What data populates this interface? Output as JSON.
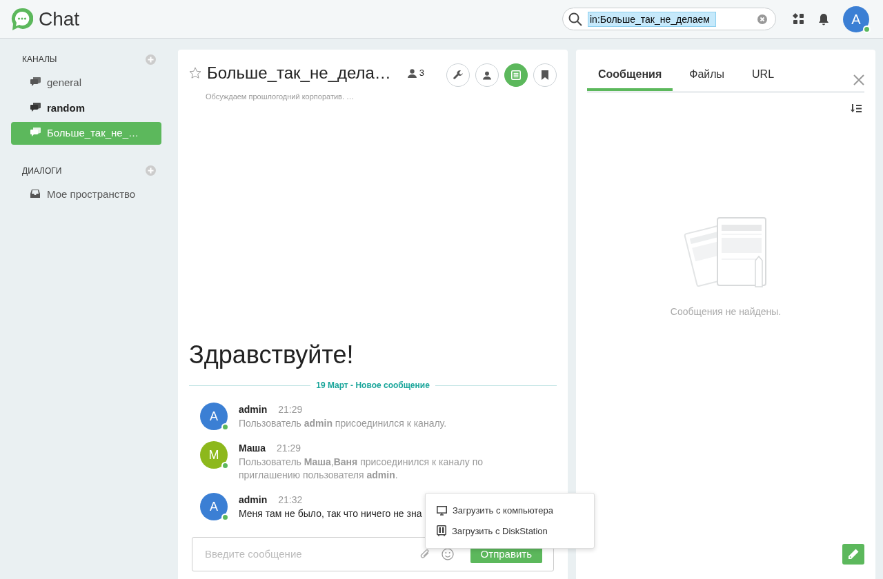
{
  "app": {
    "title": "Chat"
  },
  "search": {
    "value": "in:Больше_так_не_делаем"
  },
  "user": {
    "initial": "A",
    "online": true
  },
  "sidebar": {
    "sections": [
      {
        "title": "КАНАЛЫ",
        "items": [
          {
            "label": "general",
            "kind": "channel",
            "unread": false,
            "selected": false
          },
          {
            "label": "random",
            "kind": "channel",
            "unread": true,
            "selected": false
          },
          {
            "label": "Больше_так_не_…",
            "kind": "channel",
            "unread": false,
            "selected": true
          }
        ]
      },
      {
        "title": "ДИАЛОГИ",
        "items": [
          {
            "label": "Мое пространство",
            "kind": "inbox",
            "unread": false,
            "selected": false
          }
        ]
      }
    ]
  },
  "channel": {
    "title": "Больше_так_не_дела…",
    "starred": false,
    "members": "3",
    "subtitle": "Обсуждаем прошлогодний корпоратив. …",
    "actions": [
      {
        "kind": "settings",
        "selected": false
      },
      {
        "kind": "members",
        "selected": false
      },
      {
        "kind": "search",
        "selected": true
      },
      {
        "kind": "bookmark",
        "selected": false
      }
    ],
    "greeting": "Здравствуйте!",
    "divider": "19 Март - Новое сообщение",
    "messages": [
      {
        "author": "admin",
        "initial": "A",
        "color": "#3b7fd4",
        "online": true,
        "time": "21:29",
        "text": "Пользователь **admin** присоединился к каналу.",
        "system": true
      },
      {
        "author": "Маша",
        "initial": "M",
        "color": "#8db81c",
        "online": true,
        "time": "21:29",
        "text": "Пользователь **Маша**,**Ваня** присоединился к каналу по приглашению пользователя **admin**.",
        "system": true
      },
      {
        "author": "admin",
        "initial": "A",
        "color": "#3b7fd4",
        "online": true,
        "time": "21:32",
        "text": "Меня там не было, так что ничего не зна",
        "system": false
      }
    ],
    "composer": {
      "placeholder": "Введите сообщение",
      "send": "Отправить"
    },
    "upload_menu": [
      {
        "kind": "computer",
        "label": "Загрузить с компьютера"
      },
      {
        "kind": "diskstation",
        "label": "Загрузить с DiskStation"
      }
    ]
  },
  "search_panel": {
    "tabs": [
      {
        "label": "Сообщения",
        "selected": true
      },
      {
        "label": "Файлы",
        "selected": false
      },
      {
        "label": "URL",
        "selected": false
      }
    ],
    "empty": "Сообщения не найдены."
  }
}
